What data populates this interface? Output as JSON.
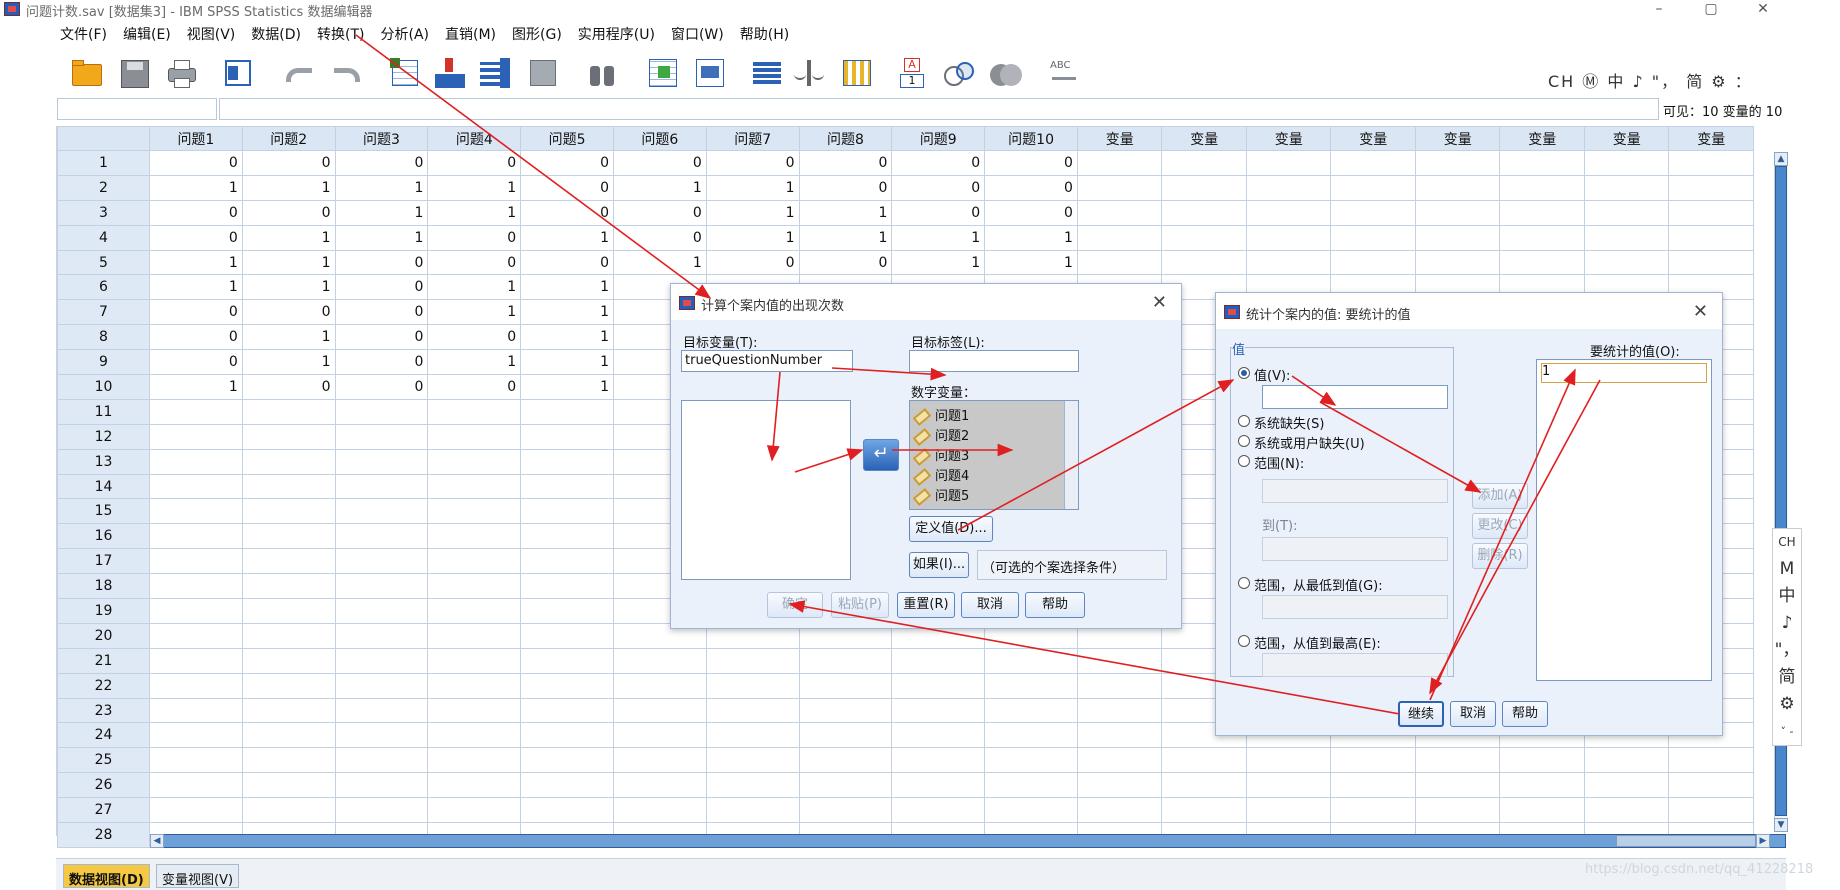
{
  "window": {
    "title": "问题计数.sav [数据集3] - IBM SPSS Statistics 数据编辑器",
    "minimize": "–",
    "maximize": "▢",
    "close": "✕"
  },
  "menus": [
    "文件(F)",
    "编辑(E)",
    "视图(V)",
    "数据(D)",
    "转换(T)",
    "分析(A)",
    "直销(M)",
    "图形(G)",
    "实用程序(U)",
    "窗口(W)",
    "帮助(H)"
  ],
  "ime": {
    "bar": "CH Ⓜ 中 ♪ \"， 简 ⚙ ：",
    "side": [
      "CH",
      "M",
      "中",
      "♪",
      "\"，",
      "简",
      "⚙",
      "˅ -"
    ]
  },
  "cell_editor": {
    "ref": "",
    "value": "",
    "visible": "可见：10 变量的 10"
  },
  "grid": {
    "columns": [
      "问题1",
      "问题2",
      "问题3",
      "问题4",
      "问题5",
      "问题6",
      "问题7",
      "问题8",
      "问题9",
      "问题10",
      "变量",
      "变量",
      "变量",
      "变量",
      "变量",
      "变量",
      "变量",
      "变量"
    ],
    "rows": [
      [
        0,
        0,
        0,
        0,
        0,
        0,
        0,
        0,
        0,
        0
      ],
      [
        1,
        1,
        1,
        1,
        0,
        1,
        1,
        0,
        0,
        0
      ],
      [
        0,
        0,
        1,
        1,
        0,
        0,
        1,
        1,
        0,
        0
      ],
      [
        0,
        1,
        1,
        0,
        1,
        0,
        1,
        1,
        1,
        1
      ],
      [
        1,
        1,
        0,
        0,
        0,
        1,
        0,
        0,
        1,
        1
      ],
      [
        1,
        1,
        0,
        1,
        1
      ],
      [
        0,
        0,
        0,
        1,
        1
      ],
      [
        0,
        1,
        0,
        0,
        1
      ],
      [
        0,
        1,
        0,
        1,
        1
      ],
      [
        1,
        0,
        0,
        0,
        1
      ]
    ],
    "row_count": 28
  },
  "tabs": {
    "data": "数据视图(D)",
    "variable": "变量视图(V)"
  },
  "watermark": "https://blog.csdn.net/qq_41228218",
  "dialog_count": {
    "title": "计算个案内值的出现次数",
    "target_var_label": "目标变量(T):",
    "target_var_value": "trueQuestionNumber",
    "target_label_label": "目标标签(L):",
    "target_label_value": "",
    "numeric_vars_label": "数字变量：",
    "numeric_vars": [
      "问题1",
      "问题2",
      "问题3",
      "问题4",
      "问题5"
    ],
    "define_values": "定义值(D)...",
    "if_button": "如果(I)...",
    "if_hint": "（可选的个案选择条件）",
    "buttons": {
      "ok": "确定",
      "paste": "粘贴(P)",
      "reset": "重置(R)",
      "cancel": "取消",
      "help": "帮助"
    }
  },
  "dialog_values": {
    "title": "统计个案内的值: 要统计的值",
    "group_label": "值",
    "value_radio": "值(V):",
    "value_input": "",
    "sysmis": "系统缺失(S)",
    "sys_or_user": "系统或用户缺失(U)",
    "range": "范围(N):",
    "to_label": "到(T):",
    "range_lowest": "范围，从最低到值(G):",
    "range_highest": "范围，从值到最高(E):",
    "add": "添加(A)",
    "change": "更改(C)",
    "remove": "删除(R)",
    "values_to_count_label": "要统计的值(O):",
    "values_to_count": [
      "1"
    ],
    "buttons": {
      "continue": "继续",
      "cancel": "取消",
      "help": "帮助"
    }
  },
  "colors": {
    "accent": "#2b62b5",
    "arrow": "#e02020",
    "header": "#dbe6f4",
    "active_tab": "#f4c842"
  }
}
